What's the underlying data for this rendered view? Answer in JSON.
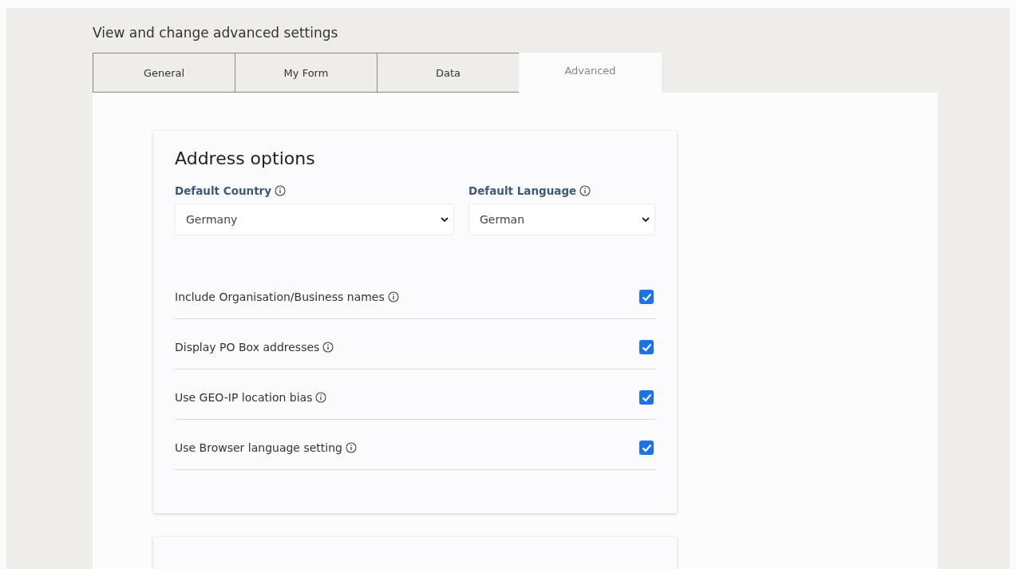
{
  "heading": "View and change advanced settings",
  "tabs": [
    {
      "label": "General",
      "selected": false
    },
    {
      "label": "My Form",
      "selected": false
    },
    {
      "label": "Data",
      "selected": false
    },
    {
      "label": "Advanced",
      "selected": true
    }
  ],
  "address_options": {
    "title": "Address options",
    "selects": [
      {
        "label": "Default Country",
        "value": "Germany"
      },
      {
        "label": "Default Language",
        "value": "German"
      }
    ],
    "options": [
      {
        "label": "Include Organisation/Business names",
        "checked": true
      },
      {
        "label": "Display PO Box addresses",
        "checked": true
      },
      {
        "label": "Use GEO-IP location bias",
        "checked": true
      },
      {
        "label": "Use Browser language setting",
        "checked": true
      }
    ]
  }
}
